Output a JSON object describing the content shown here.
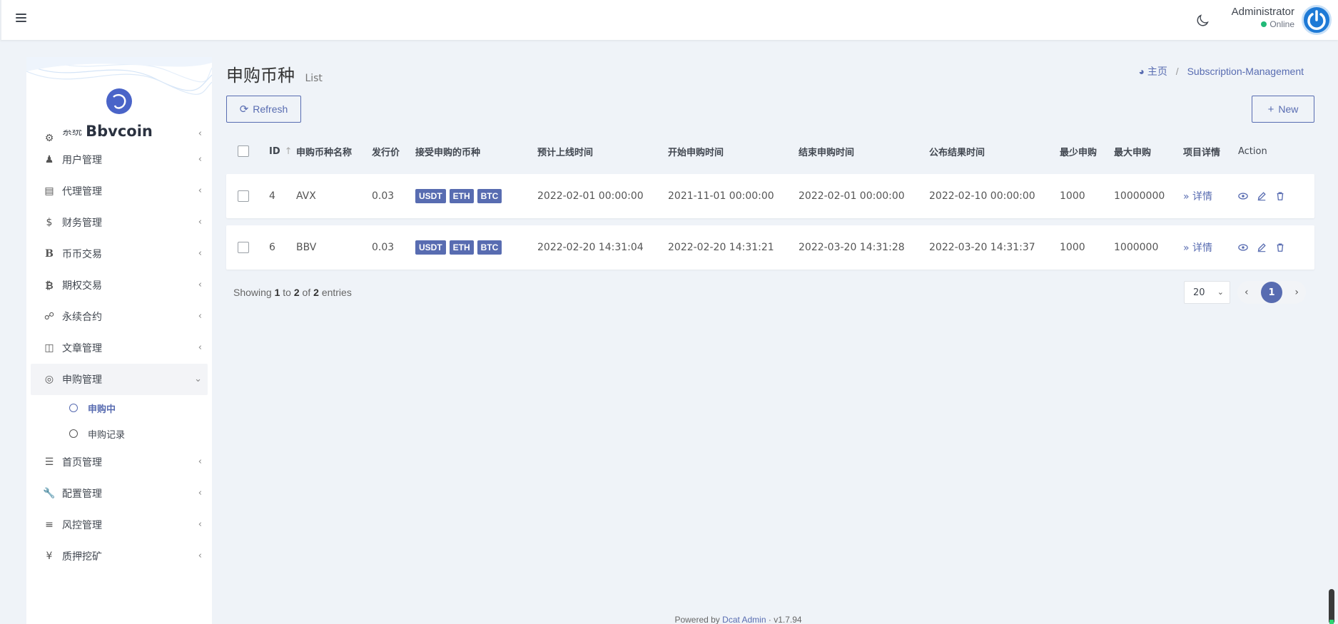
{
  "header": {
    "user_name": "Administrator",
    "user_status": "Online"
  },
  "sidebar": {
    "brand": "Bbvcoin",
    "partial_item": "系统",
    "items": [
      {
        "label": "用户管理",
        "icon": "users-icon"
      },
      {
        "label": "代理管理",
        "icon": "id-card-icon"
      },
      {
        "label": "财务管理",
        "icon": "dollar-icon"
      },
      {
        "label": "币币交易",
        "icon": "b-icon"
      },
      {
        "label": "期权交易",
        "icon": "bitcoin-icon"
      },
      {
        "label": "永续合约",
        "icon": "link-icon"
      },
      {
        "label": "文章管理",
        "icon": "newspaper-icon"
      },
      {
        "label": "申购管理",
        "icon": "lifebuoy-icon"
      },
      {
        "label": "首页管理",
        "icon": "list-icon"
      },
      {
        "label": "配置管理",
        "icon": "wrench-icon"
      },
      {
        "label": "风控管理",
        "icon": "indent-icon"
      },
      {
        "label": "质押挖矿",
        "icon": "yen-icon"
      }
    ],
    "sub_items": [
      {
        "label": "申购中"
      },
      {
        "label": "申购记录"
      }
    ]
  },
  "page": {
    "title": "申购币种",
    "subtitle": "List",
    "breadcrumb_home": "主页",
    "breadcrumb_current": "Subscription-Management",
    "refresh_label": "Refresh",
    "new_label": "New"
  },
  "table": {
    "columns": [
      "ID",
      "申购币种名称",
      "发行价",
      "接受申购的币种",
      "预计上线时间",
      "开始申购时间",
      "结束申购时间",
      "公布结果时间",
      "最少申购",
      "最大申购",
      "项目详情",
      "Action"
    ],
    "rows": [
      {
        "id": "4",
        "name": "AVX",
        "price": "0.03",
        "coins": [
          "USDT",
          "ETH",
          "BTC"
        ],
        "t1": "2022-02-01 00:00:00",
        "t2": "2021-11-01 00:00:00",
        "t3": "2022-02-01 00:00:00",
        "t4": "2022-02-10 00:00:00",
        "min": "1000",
        "max": "10000000",
        "detail": "详情"
      },
      {
        "id": "6",
        "name": "BBV",
        "price": "0.03",
        "coins": [
          "USDT",
          "ETH",
          "BTC"
        ],
        "t1": "2022-02-20 14:31:04",
        "t2": "2022-02-20 14:31:21",
        "t3": "2022-03-20 14:31:28",
        "t4": "2022-03-20 14:31:37",
        "min": "1000",
        "max": "1000000",
        "detail": "详情"
      }
    ]
  },
  "pagination": {
    "showing_prefix": "Showing",
    "from": "1",
    "to_word": "to",
    "to": "2",
    "of_word": "of",
    "total": "2",
    "entries_word": "entries",
    "per_page": "20",
    "current_page": "1"
  },
  "footer": {
    "powered_by": "Powered by",
    "link_text": "Dcat Admin",
    "version": "v1.7.94"
  },
  "colors": {
    "accent": "#586cb1",
    "online": "#21b978"
  }
}
